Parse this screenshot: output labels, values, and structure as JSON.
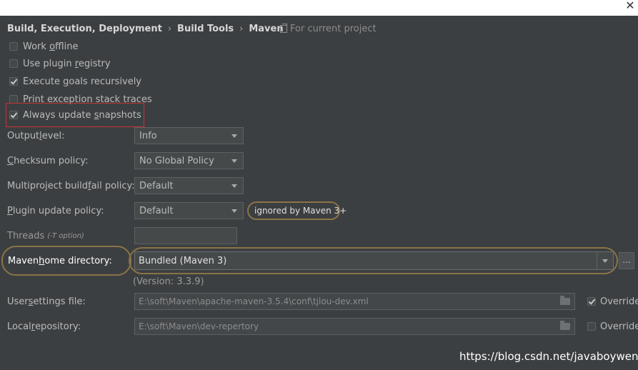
{
  "window": {
    "close_glyph": "✕"
  },
  "breadcrumb": {
    "items": [
      "Build, Execution, Deployment",
      "Build Tools",
      "Maven"
    ],
    "separator": "›"
  },
  "scope": {
    "label": "For current project",
    "icon": "page-icon"
  },
  "checkboxes": [
    {
      "pre": "Work ",
      "u": "o",
      "post": "ffline",
      "checked": false
    },
    {
      "pre": "Use plugin ",
      "u": "r",
      "post": "egistry",
      "checked": false
    },
    {
      "pre": "Execute ",
      "u": "g",
      "post": "oals recursively",
      "checked": true
    },
    {
      "pre": "Print exception stack traces",
      "u": "",
      "post": "",
      "checked": false
    },
    {
      "pre": "Always update ",
      "u": "s",
      "post": "napshots",
      "checked": true
    }
  ],
  "fields": {
    "output_level": {
      "label_pre": "Output ",
      "label_u": "l",
      "label_post": "evel:",
      "value": "Info"
    },
    "checksum_policy": {
      "label_pre": "",
      "label_u": "C",
      "label_post": "hecksum policy:",
      "value": "No Global Policy"
    },
    "multiproject_fail_policy": {
      "label_pre": "Multiproject build ",
      "label_u": "f",
      "label_post": "ail policy:",
      "value": "Default"
    },
    "plugin_update_policy": {
      "label_pre": "",
      "label_u": "P",
      "label_post": "lugin update policy:",
      "value": "Default"
    }
  },
  "plugin_update_hint": "ignored by Maven 3+",
  "threads": {
    "label": "Threads",
    "option": "(-T option)",
    "value": ""
  },
  "maven_home": {
    "label_pre": "Maven ",
    "label_u": "h",
    "label_post": "ome directory:",
    "value": "Bundled (Maven 3)",
    "version": "(Version: 3.3.9)",
    "browse_label": "..."
  },
  "user_settings": {
    "label_pre": "User ",
    "label_u": "s",
    "label_post": "ettings file:",
    "value": "E:\\soft\\Maven\\apache-maven-3.5.4\\conf\\tjlou-dev.xml",
    "override_label": "Override",
    "override_checked": true
  },
  "local_repository": {
    "label_pre": "Local ",
    "label_u": "r",
    "label_post": "epository:",
    "value": "E:\\soft\\Maven\\dev-repertory",
    "override_label": "Override",
    "override_checked": false
  },
  "watermark": "https://blog.csdn.net/javaboyweng",
  "colors": {
    "background": "#3c3f41",
    "text": "#bbbbbb",
    "highlight_red": "#c23438",
    "highlight_gold": "#8a7346"
  }
}
